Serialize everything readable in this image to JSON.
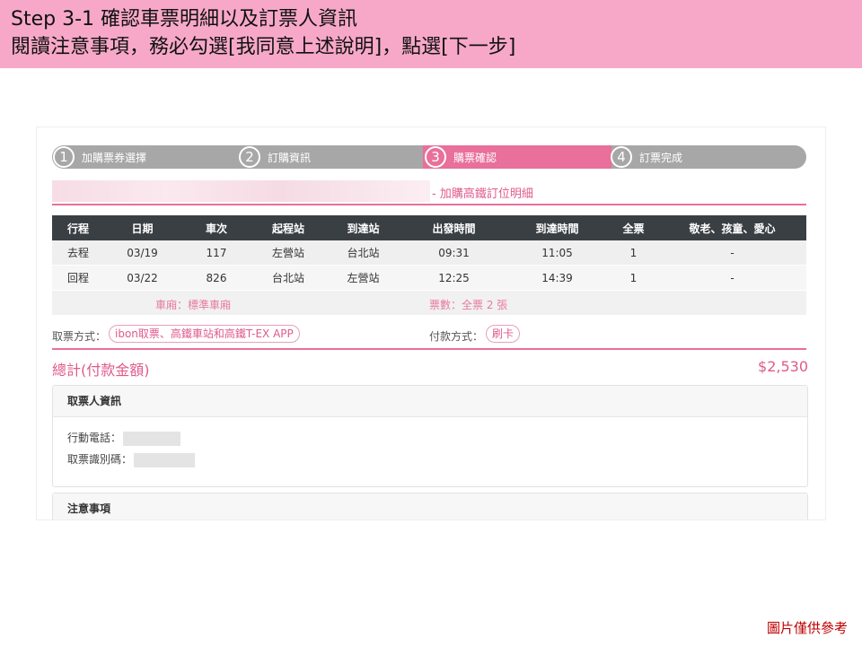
{
  "banner": {
    "line1": "Step 3-1 確認車票明細以及訂票人資訊",
    "line2": "閱讀注意事項，務必勾選[我同意上述說明]，點選[下一步]"
  },
  "steps": [
    {
      "num": "1",
      "label": "加購票券選擇"
    },
    {
      "num": "2",
      "label": "訂購資訊"
    },
    {
      "num": "3",
      "label": "購票確認"
    },
    {
      "num": "4",
      "label": "訂票完成"
    }
  ],
  "section_title": "- 加購高鐵訂位明細",
  "table": {
    "headers": [
      "行程",
      "日期",
      "車次",
      "起程站",
      "到達站",
      "出發時間",
      "到達時間",
      "全票",
      "敬老、孩童、愛心"
    ],
    "rows": [
      [
        "去程",
        "03/19",
        "117",
        "左營站",
        "台北站",
        "09:31",
        "11:05",
        "1",
        "-"
      ],
      [
        "回程",
        "03/22",
        "826",
        "台北站",
        "左營站",
        "12:25",
        "14:39",
        "1",
        "-"
      ]
    ],
    "car_type": "車廂：標準車廂",
    "ticket_count": "票數：全票 2 張"
  },
  "pickup": {
    "label": "取票方式：",
    "value": "ibon取票、高鐵車站和高鐵T-EX APP"
  },
  "payment": {
    "label": "付款方式：",
    "value": "刷卡"
  },
  "total": {
    "label": "總計(付款金額)",
    "amount": "$2,530"
  },
  "ticket_holder": {
    "title": "取票人資訊",
    "phone_label": "行動電話：",
    "id_label": "取票識別碼："
  },
  "notice": {
    "title": "注意事項"
  },
  "footnote": "圖片僅供參考",
  "colors": {
    "accent": "#e8709a",
    "banner": "#f7a8c8",
    "table_header": "#3a3f44"
  }
}
